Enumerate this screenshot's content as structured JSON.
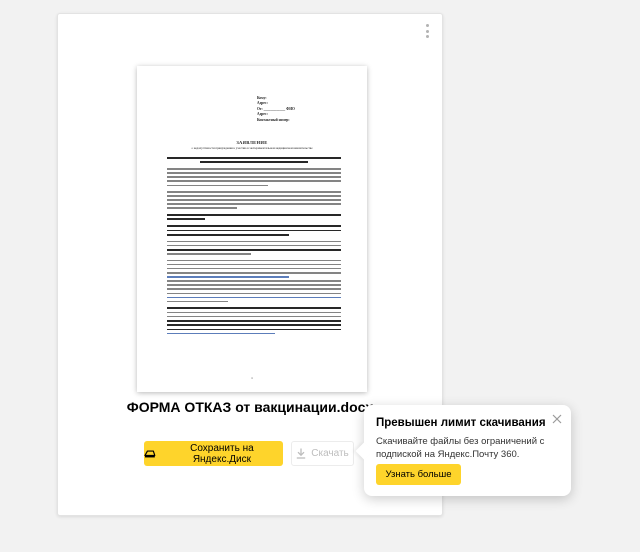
{
  "document": {
    "file_name": "ФОРМА ОТКАЗ от вакцинации.docx",
    "preview": {
      "header_lines": [
        "Кому:",
        "Адрес:",
        "От: ____________ ФИО",
        "Адрес:",
        "Контактный номер:"
      ],
      "title": "ЗАЯВЛЕНИЕ",
      "subtitle": "о недопустимости принуждения к участию в экспериментальном медицинском вмешательстве",
      "page_number": "1"
    }
  },
  "actions": {
    "save_to_disk": "Сохранить на Яндекс.Диск",
    "download": "Скачать"
  },
  "limit_popup": {
    "title": "Превышен лимит скачивания",
    "text": "Скачивайте файлы без ограничений с подпиской на Яндекс.Почту 360.",
    "button": "Узнать больше"
  },
  "colors": {
    "accent_yellow": "#fed42b",
    "background": "#f2f2f2"
  },
  "icons": {
    "menu": "kebab-menu-icon",
    "save": "disk-icon",
    "download": "download-icon",
    "close": "close-icon"
  }
}
